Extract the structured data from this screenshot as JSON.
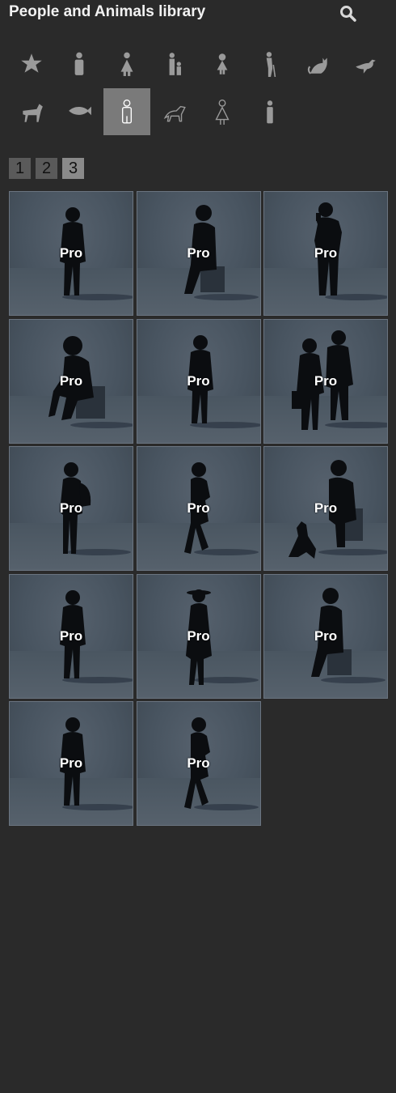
{
  "header": {
    "title": "People and Animals library",
    "search_icon": "search-icon"
  },
  "categories": [
    {
      "name": "favorites",
      "icon": "star-icon",
      "active": false
    },
    {
      "name": "man",
      "icon": "man-icon",
      "active": false
    },
    {
      "name": "woman",
      "icon": "woman-icon",
      "active": false
    },
    {
      "name": "family",
      "icon": "parent-child-icon",
      "active": false
    },
    {
      "name": "child",
      "icon": "child-icon",
      "active": false
    },
    {
      "name": "elderly",
      "icon": "elderly-icon",
      "active": false
    },
    {
      "name": "cat",
      "icon": "cat-icon",
      "active": false
    },
    {
      "name": "bird",
      "icon": "bird-icon",
      "active": false
    },
    {
      "name": "horse",
      "icon": "horse-icon",
      "active": false
    },
    {
      "name": "fish",
      "icon": "fish-icon",
      "active": false
    },
    {
      "name": "man-outline",
      "icon": "man-outline-icon",
      "active": true
    },
    {
      "name": "dog",
      "icon": "dog-outline-icon",
      "active": false
    },
    {
      "name": "woman-outline",
      "icon": "woman-outline-icon",
      "active": false
    },
    {
      "name": "person",
      "icon": "person-icon",
      "active": false
    }
  ],
  "pages": [
    {
      "label": "1",
      "active": false
    },
    {
      "label": "2",
      "active": false
    },
    {
      "label": "3",
      "active": true
    }
  ],
  "tiles": [
    {
      "badge": "Pro",
      "figure": "man-standing"
    },
    {
      "badge": "Pro",
      "figure": "woman-sitting-box"
    },
    {
      "badge": "Pro",
      "figure": "man-on-phone"
    },
    {
      "badge": "Pro",
      "figure": "boy-sitting-box"
    },
    {
      "badge": "Pro",
      "figure": "man-standing"
    },
    {
      "badge": "Pro",
      "figure": "two-men-talking"
    },
    {
      "badge": "Pro",
      "figure": "man-with-backpack"
    },
    {
      "badge": "Pro",
      "figure": "woman-walking"
    },
    {
      "badge": "Pro",
      "figure": "man-sitting-with-dog"
    },
    {
      "badge": "Pro",
      "figure": "man-standing"
    },
    {
      "badge": "Pro",
      "figure": "woman-with-hat"
    },
    {
      "badge": "Pro",
      "figure": "woman-sitting-box"
    },
    {
      "badge": "Pro",
      "figure": "man-standing"
    },
    {
      "badge": "Pro",
      "figure": "woman-walking"
    }
  ]
}
